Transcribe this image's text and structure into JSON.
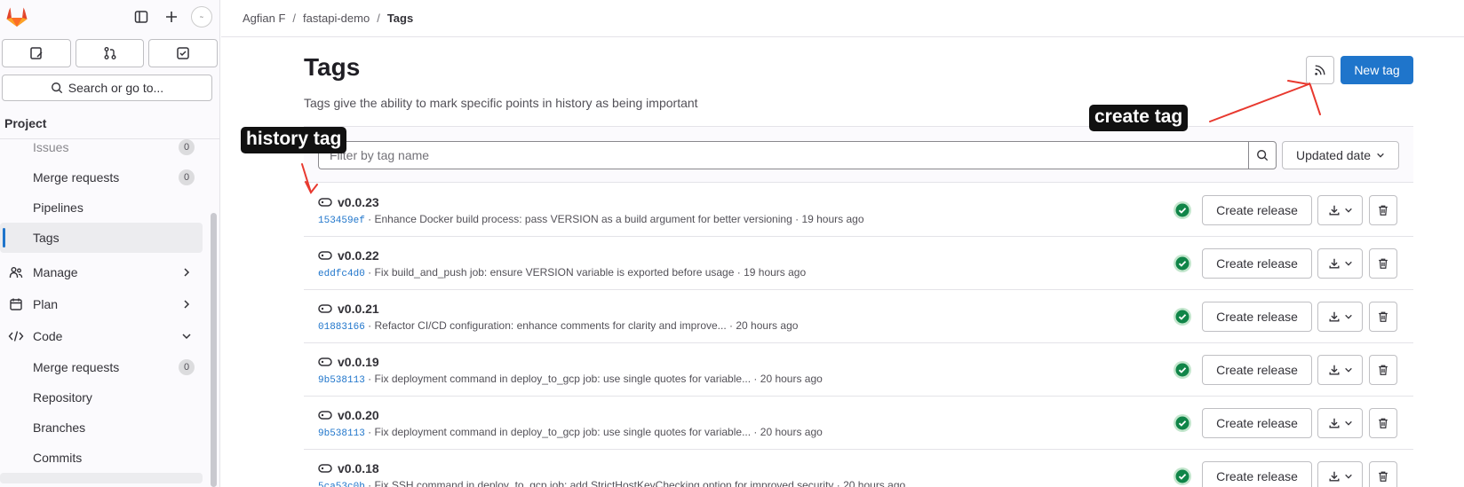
{
  "sidebar": {
    "search_label": "Search or go to...",
    "section_title": "Project",
    "items": [
      {
        "label": "Issues",
        "count": "0"
      },
      {
        "label": "Merge requests",
        "count": "0"
      },
      {
        "label": "Pipelines"
      },
      {
        "label": "Tags"
      }
    ],
    "groups": [
      {
        "label": "Manage"
      },
      {
        "label": "Plan"
      },
      {
        "label": "Code"
      }
    ],
    "code_items": [
      {
        "label": "Merge requests",
        "count": "0"
      },
      {
        "label": "Repository"
      },
      {
        "label": "Branches"
      },
      {
        "label": "Commits"
      }
    ]
  },
  "breadcrumb": {
    "owner": "Agfian F",
    "project": "fastapi-demo",
    "current": "Tags",
    "sep": "/"
  },
  "page": {
    "title": "Tags",
    "description": "Tags give the ability to mark specific points in history as being important",
    "new_tag_label": "New tag"
  },
  "filter": {
    "placeholder": "Filter by tag name",
    "sort_label": "Updated date"
  },
  "tags": [
    {
      "name": "v0.0.23",
      "sha": "153459ef",
      "message": "Enhance Docker build process: pass VERSION as a build argument for better versioning",
      "time": "19 hours ago"
    },
    {
      "name": "v0.0.22",
      "sha": "eddfc4d0",
      "message": "Fix build_and_push job: ensure VERSION variable is exported before usage",
      "time": "19 hours ago"
    },
    {
      "name": "v0.0.21",
      "sha": "01883166",
      "message": "Refactor CI/CD configuration: enhance comments for clarity and improve...",
      "time": "20 hours ago"
    },
    {
      "name": "v0.0.19",
      "sha": "9b538113",
      "message": "Fix deployment command in deploy_to_gcp job: use single quotes for variable...",
      "time": "20 hours ago"
    },
    {
      "name": "v0.0.20",
      "sha": "9b538113",
      "message": "Fix deployment command in deploy_to_gcp job: use single quotes for variable...",
      "time": "20 hours ago"
    },
    {
      "name": "v0.0.18",
      "sha": "5ca53c0b",
      "message": "Fix SSH command in deploy_to_gcp job: add StrictHostKeyChecking option for improved security",
      "time": "20 hours ago"
    }
  ],
  "row_actions": {
    "create_release_label": "Create release"
  },
  "annotations": {
    "history_tag": "history tag",
    "create_tag": "create tag"
  },
  "colors": {
    "accent": "#1f75cb",
    "success": "#108548",
    "annotation_arrow": "#e8392f"
  }
}
